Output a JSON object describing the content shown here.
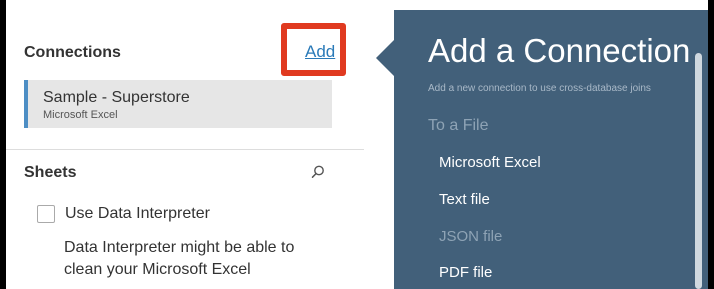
{
  "connections": {
    "title": "Connections",
    "add_label": "Add",
    "items": [
      {
        "name": "Sample - Superstore",
        "type": "Microsoft Excel"
      }
    ]
  },
  "sheets": {
    "title": "Sheets",
    "search_icon": "search-icon",
    "data_interpreter": {
      "checked": false,
      "label": "Use Data Interpreter",
      "description": "Data Interpreter might be able to clean your Microsoft Excel"
    }
  },
  "add_connection": {
    "title": "Add a Connection",
    "subtitle": "Add a new connection to use cross-database joins",
    "section_to_file": "To a File",
    "items": [
      {
        "label": "Microsoft Excel",
        "enabled": true
      },
      {
        "label": "Text file",
        "enabled": true
      },
      {
        "label": "JSON file",
        "enabled": false
      },
      {
        "label": "PDF file",
        "enabled": true
      }
    ]
  },
  "colors": {
    "popup_bg": "#42607a",
    "highlight_box": "#e03a20",
    "link": "#2a7ab8",
    "selected_accent": "#4d8ec4"
  }
}
